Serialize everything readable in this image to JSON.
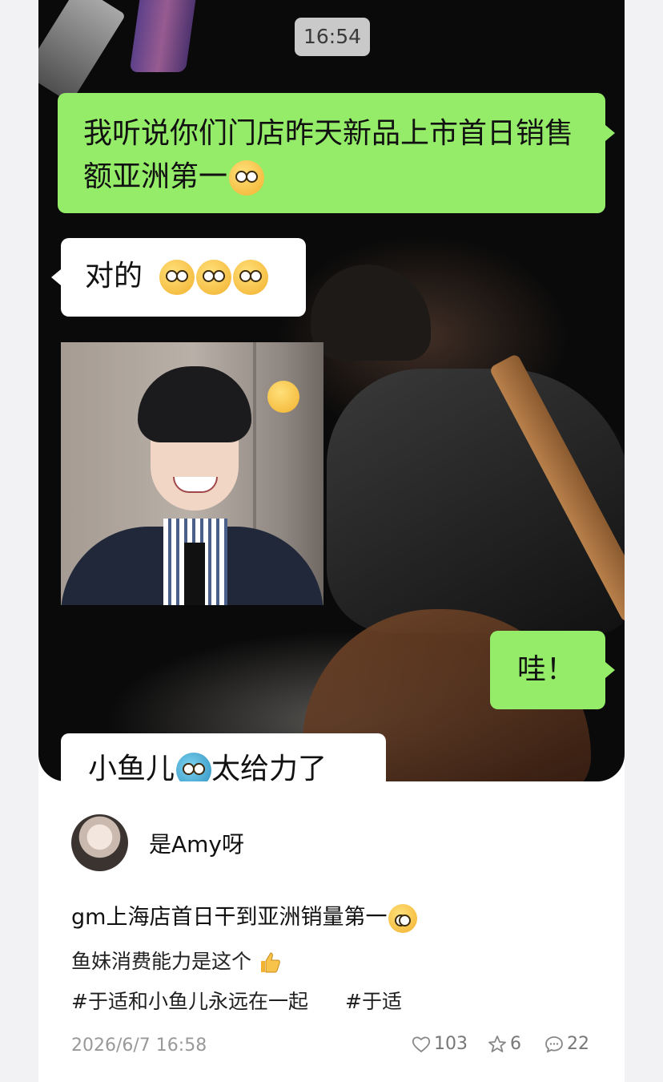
{
  "chat": {
    "time": "16:54",
    "msg1": "我听说你们门店昨天新品上市首日销售额亚洲第一",
    "msg2": "对的",
    "msg3": "哇！",
    "msg4": "小鱼儿",
    "msg4_tail": "太给力了"
  },
  "post": {
    "username": "是Amy呀",
    "title": "gm上海店首日干到亚洲销量第一",
    "line2": "鱼妹消费能力是这个",
    "tags": [
      "#于适和小鱼儿永远在一起",
      "#于适"
    ],
    "date": "2026/6/7 16:58",
    "likes": "103",
    "favorites": "6",
    "comments": "22"
  },
  "colors": {
    "bubble_green": "#95ec69",
    "bubble_white": "#ffffff",
    "chat_bg": "#0a0a0a"
  }
}
